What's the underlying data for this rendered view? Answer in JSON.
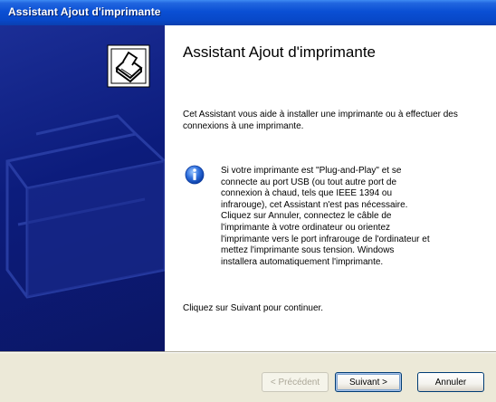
{
  "window": {
    "title": "Assistant Ajout d'imprimante"
  },
  "content": {
    "heading": "Assistant Ajout d'imprimante",
    "intro": "Cet Assistant vous aide à installer une imprimante ou à effectuer des connexions à une imprimante.",
    "info_icon": "information-icon",
    "info_lines": [
      "Si votre imprimante est \"Plug-and-Play\" et se",
      "connecte au port USB (ou tout autre port de",
      "connexion à chaud, tels que IEEE 1394 ou",
      "infrarouge), cet Assistant n'est pas nécessaire.",
      "Cliquez sur Annuler, connectez le câble de",
      "l'imprimante à votre ordinateur ou orientez",
      "l'imprimante vers le port infrarouge de l'ordinateur et",
      "mettez l'imprimante sous tension. Windows",
      "installera automatiquement l'imprimante."
    ],
    "continue_text": "Cliquez sur Suivant pour continuer."
  },
  "sidebar": {
    "graphic_icon": "printer-icon"
  },
  "buttons": {
    "back_label": "< Précédent",
    "next_label": "Suivant >",
    "cancel_label": "Annuler"
  },
  "colors": {
    "title_bar": "#0a4fd4",
    "sidebar": "#0c1c7c",
    "dialog_face": "#ece9d8"
  }
}
